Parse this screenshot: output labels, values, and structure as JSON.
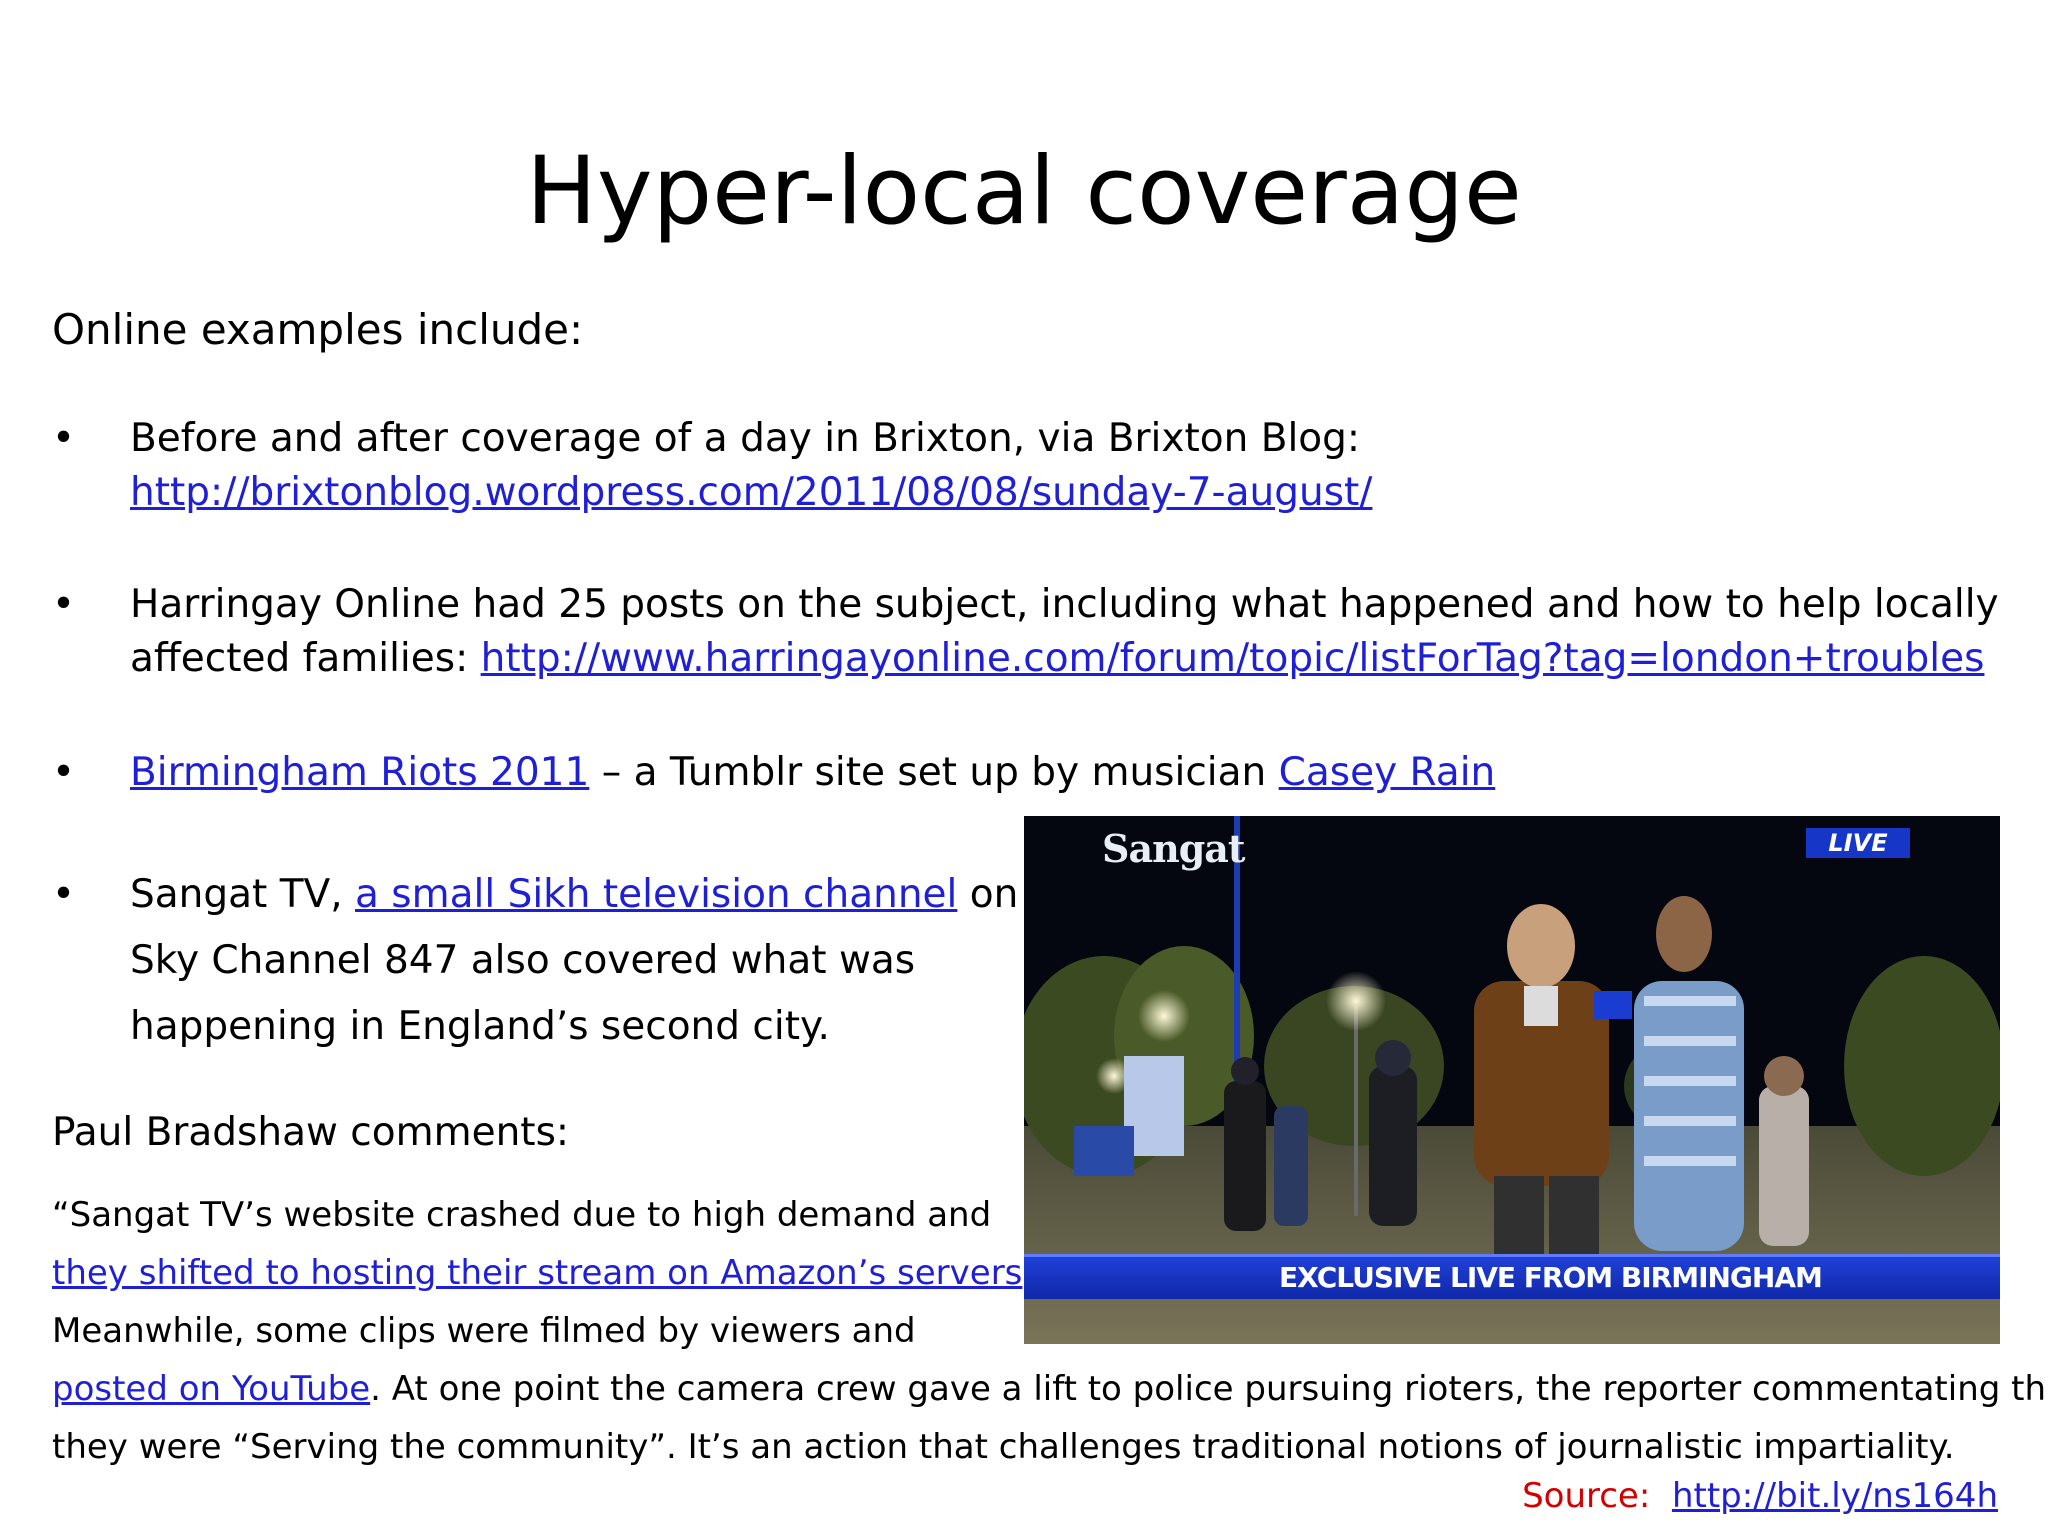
{
  "slide": {
    "title": "Hyper-local coverage",
    "intro": "Online examples include:",
    "bullet_char": "•",
    "bullets": [
      {
        "text_before": "Before and after coverage of a day in Brixton, via Brixton Blog:",
        "link": "http://brixtonblog.wordpress.com/2011/08/08/sunday-7-august/"
      },
      {
        "line1": "Harringay Online had 25 posts on the subject, including what happened and how to help locally",
        "line2_prefix": "affected families: ",
        "link": "http://www.harringayonline.com/forum/topic/listForTag?tag=london+troubles"
      },
      {
        "link1": "Birmingham Riots 2011",
        "middle": " – a Tumblr site set up by musician ",
        "link2": "Casey Rain"
      },
      {
        "prefix": "Sangat TV, ",
        "link": "a small Sikh television channel",
        "line1_suffix": " on",
        "line2": "Sky Channel 847 also covered what was",
        "line3": "happening in England’s second city."
      }
    ],
    "comments_heading": "Paul Bradshaw comments:",
    "quote": {
      "line1": "“Sangat TV’s website crashed due to high demand and",
      "link1": "they shifted to hosting their stream on Amazon’s servers",
      "line2_suffix": ".",
      "line3": "Meanwhile, some clips were filmed by viewers and",
      "link2": "posted on YouTube",
      "line4_suffix": ". At one point the camera crew gave a lift to police pursuing rioters, the reporter commentating that",
      "line5": "they were “Serving  the community”. It’s an action that challenges traditional notions of journalistic impartiality."
    },
    "source": {
      "label": "Source:",
      "link": "http://bit.ly/ns164h"
    },
    "photo": {
      "logo": "Sangat",
      "live_badge": "LIVE",
      "banner": "EXCLUSIVE LIVE FROM BIRMINGHAM"
    }
  },
  "colors": {
    "link": "#1f1fd6",
    "source_label": "#d40000",
    "banner": "#1a34c8"
  }
}
